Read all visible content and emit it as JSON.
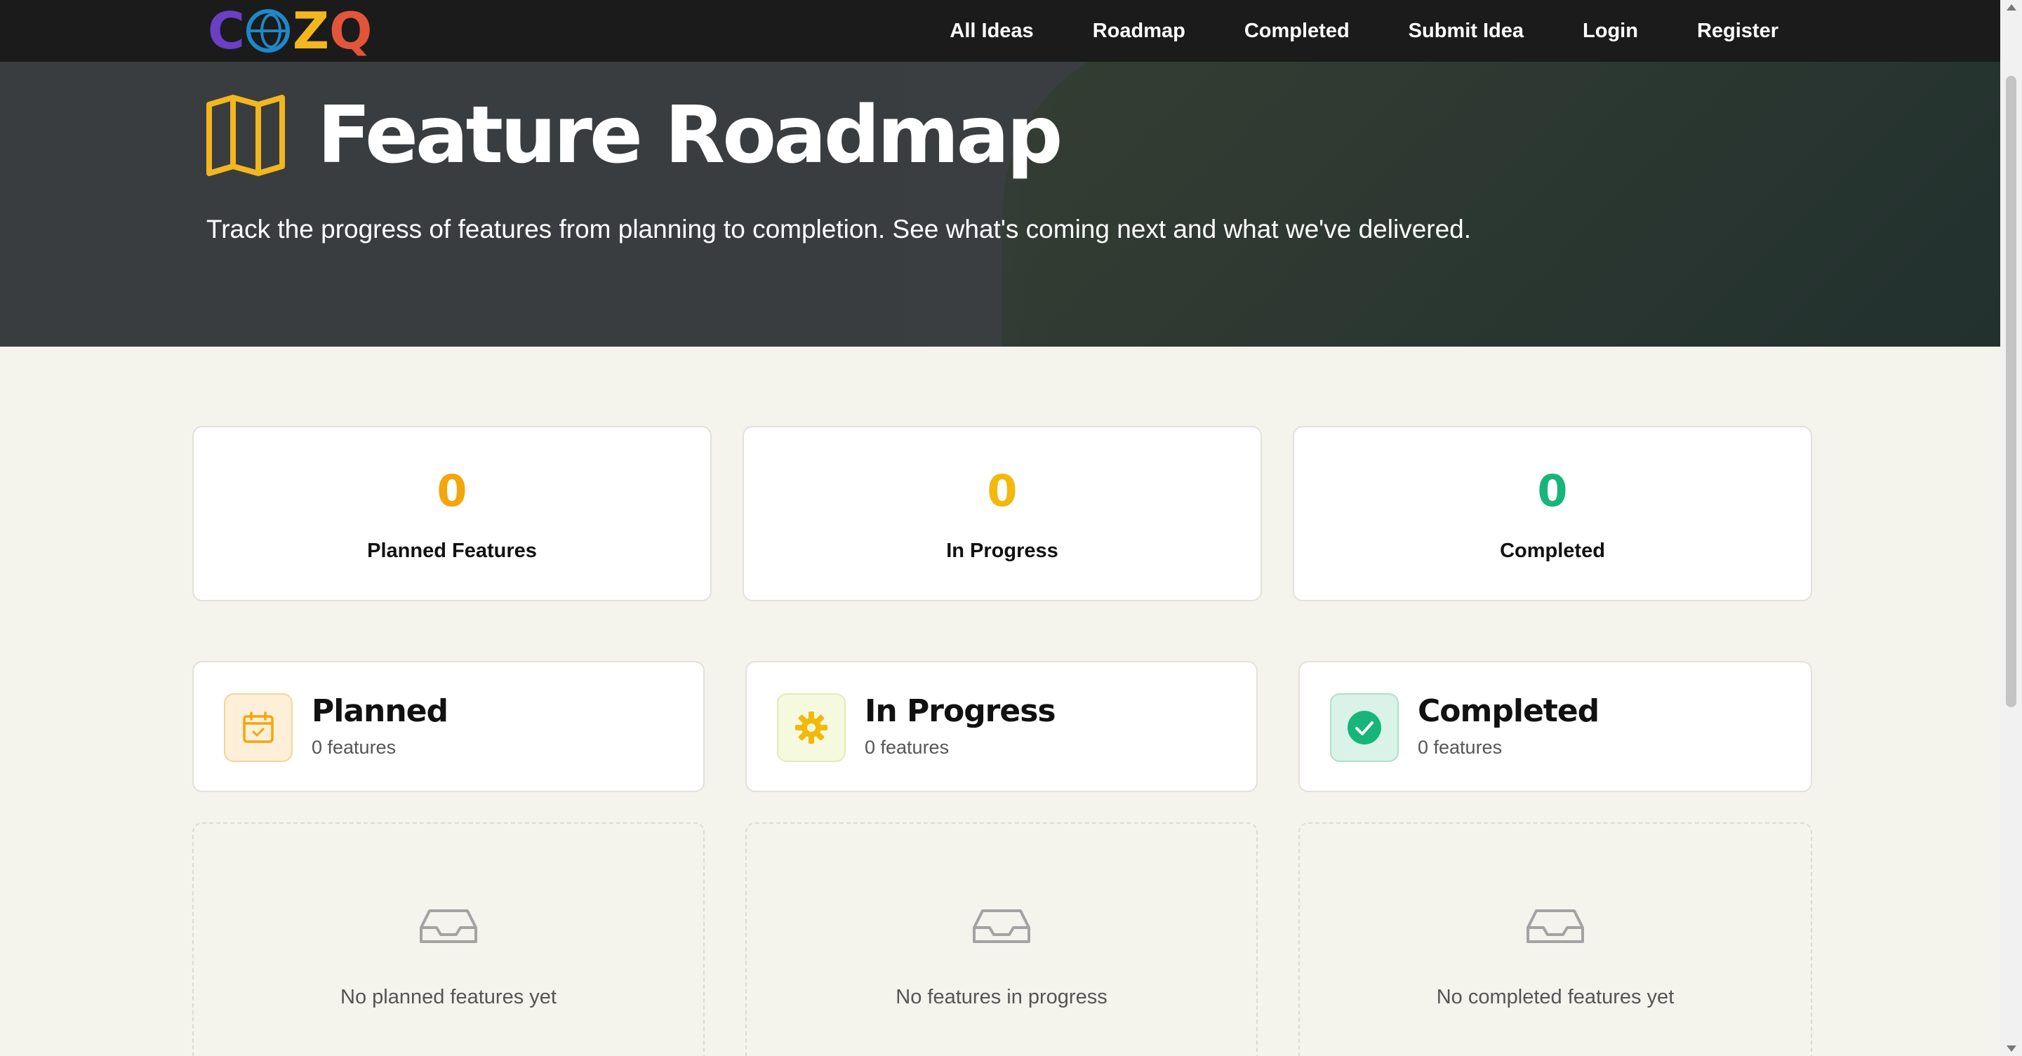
{
  "nav": {
    "logo_text": [
      "C",
      "Z",
      "Q"
    ],
    "logo_colors": [
      "#6a3fc4",
      "#1e88c8",
      "#f2b61f",
      "#e2553a"
    ],
    "links": [
      "All Ideas",
      "Roadmap",
      "Completed",
      "Submit Idea",
      "Login",
      "Register"
    ]
  },
  "hero": {
    "title": "Feature Roadmap",
    "subtitle": "Track the progress of features from planning to completion. See what's coming next and what we've delivered.",
    "icon": "map-icon"
  },
  "stats": [
    {
      "value": "0",
      "label": "Planned Features",
      "color": "#f2a60c"
    },
    {
      "value": "0",
      "label": "In Progress",
      "color": "#f2b80c"
    },
    {
      "value": "0",
      "label": "Completed",
      "color": "#17b57a"
    }
  ],
  "columns": [
    {
      "title": "Planned",
      "count": "0 features",
      "icon": "calendar-icon",
      "empty_message": "No planned features yet"
    },
    {
      "title": "In Progress",
      "count": "0 features",
      "icon": "gear-icon",
      "empty_message": "No features in progress"
    },
    {
      "title": "Completed",
      "count": "0 features",
      "icon": "check-circle-icon",
      "empty_message": "No completed features yet"
    }
  ],
  "colors": {
    "nav_bg": "#1b1b1b",
    "hero_bg": "#3b3e41",
    "page_bg": "#f4f3ec",
    "accent_yellow": "#f2b61f",
    "accent_green": "#17b57a"
  }
}
